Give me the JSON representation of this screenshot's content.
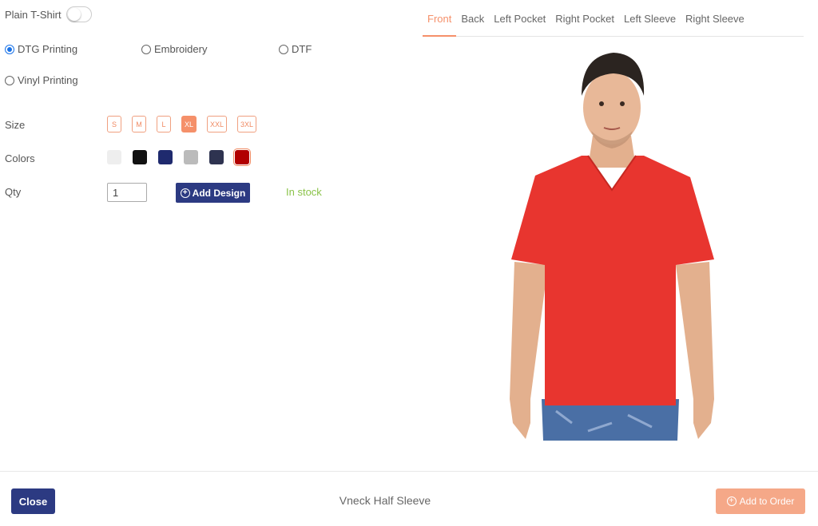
{
  "plain_tshirt": {
    "label": "Plain T-Shirt",
    "enabled": false
  },
  "printing_options": [
    {
      "label": "DTG Printing",
      "checked": true
    },
    {
      "label": "Embroidery",
      "checked": false
    },
    {
      "label": "DTF",
      "checked": false
    },
    {
      "label": "Vinyl Printing",
      "checked": false
    }
  ],
  "size": {
    "label": "Size",
    "options": [
      "S",
      "M",
      "L",
      "XL",
      "XXL",
      "3XL"
    ],
    "selected": "XL"
  },
  "colors": {
    "label": "Colors",
    "swatches": [
      "#eeeeee",
      "#111111",
      "#1f2a6e",
      "#bbbbbb",
      "#2e3350",
      "#b10000"
    ],
    "selected_index": 5
  },
  "qty": {
    "label": "Qty",
    "value": "1",
    "add_design_label": "Add Design",
    "stock_status": "In stock"
  },
  "view_tabs": [
    "Front",
    "Back",
    "Left Pocket",
    "Right Pocket",
    "Left Sleeve",
    "Right Sleeve"
  ],
  "active_tab": "Front",
  "product": {
    "shirt_color": "#e8352f",
    "name": "Vneck Half Sleeve"
  },
  "footer": {
    "close_label": "Close",
    "add_to_order_label": "Add to Order"
  },
  "colors_theme": {
    "accent": "#f5906a",
    "primary": "#2c3a82",
    "stock_green": "#8bc34a"
  }
}
